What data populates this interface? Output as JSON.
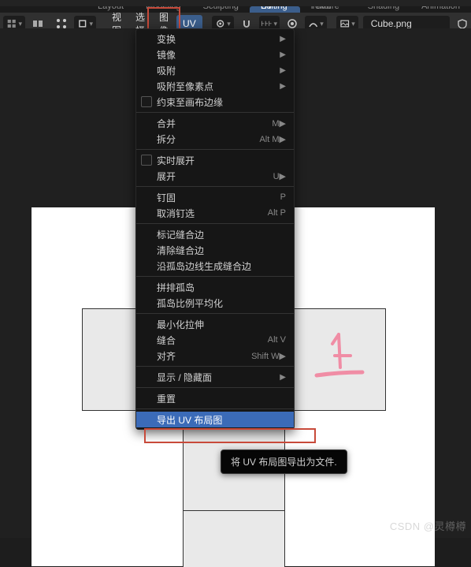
{
  "tabs": {
    "layout": "Layout",
    "modeling": "Modeling",
    "sculpting": "Sculpting",
    "uv_editing": "UV Editing",
    "texture_paint": "Texture Paint",
    "shading": "Shading",
    "animation": "Animation"
  },
  "header": {
    "view": "视图",
    "select": "选择",
    "image": "图像",
    "uv": "UV",
    "image_name": "Cube.png"
  },
  "menu": {
    "transform": "变换",
    "mirror": "镜像",
    "snap": "吸附",
    "snap_to_pixels": "吸附至像素点",
    "constrain_to_bounds": "约束至画布边缘",
    "merge": "合并",
    "merge_key": "M",
    "split": "拆分",
    "split_key": "Alt M",
    "live_unwrap": "实时展开",
    "unwrap": "展开",
    "unwrap_key": "U",
    "pin": "钉固",
    "pin_key": "P",
    "unpin": "取消钉选",
    "unpin_key": "Alt P",
    "mark_seam": "标记缝合边",
    "clear_seam": "清除缝合边",
    "seams_from_islands": "沿孤岛边线生成缝合边",
    "pack_islands": "拼排孤岛",
    "average_islands_scale": "孤岛比例平均化",
    "minimize_stretch": "最小化拉伸",
    "stitch": "缝合",
    "stitch_key": "Alt V",
    "align": "对齐",
    "align_key": "Shift W",
    "show_hide": "显示 / 隐藏面",
    "reset": "重置",
    "export_uv": "导出 UV 布局图"
  },
  "tooltip": {
    "export_uv_desc": "将 UV 布局图导出为文件."
  },
  "annotation": "上",
  "watermark": "CSDN @灵樽樽"
}
